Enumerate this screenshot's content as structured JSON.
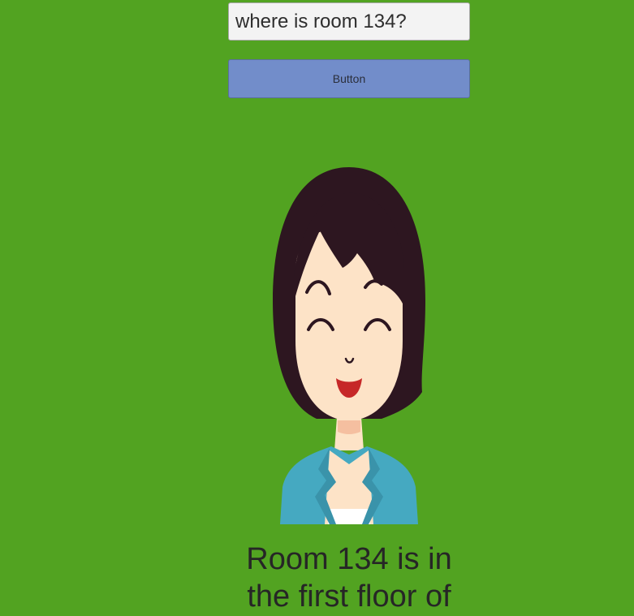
{
  "query_input": {
    "value": "where is room 134?"
  },
  "send_button": {
    "label": "Button"
  },
  "avatar": {
    "icon": "woman-avatar-icon"
  },
  "response": {
    "lines": [
      "Room 134 is in",
      "the first floor of"
    ]
  },
  "colors": {
    "background": "#52a321",
    "button": "#728dca",
    "input": "#f3f3f3",
    "hair": "#2d1620",
    "skin": "#fde3c7",
    "jacket": "#45a9c1",
    "mouth": "#c62828"
  }
}
